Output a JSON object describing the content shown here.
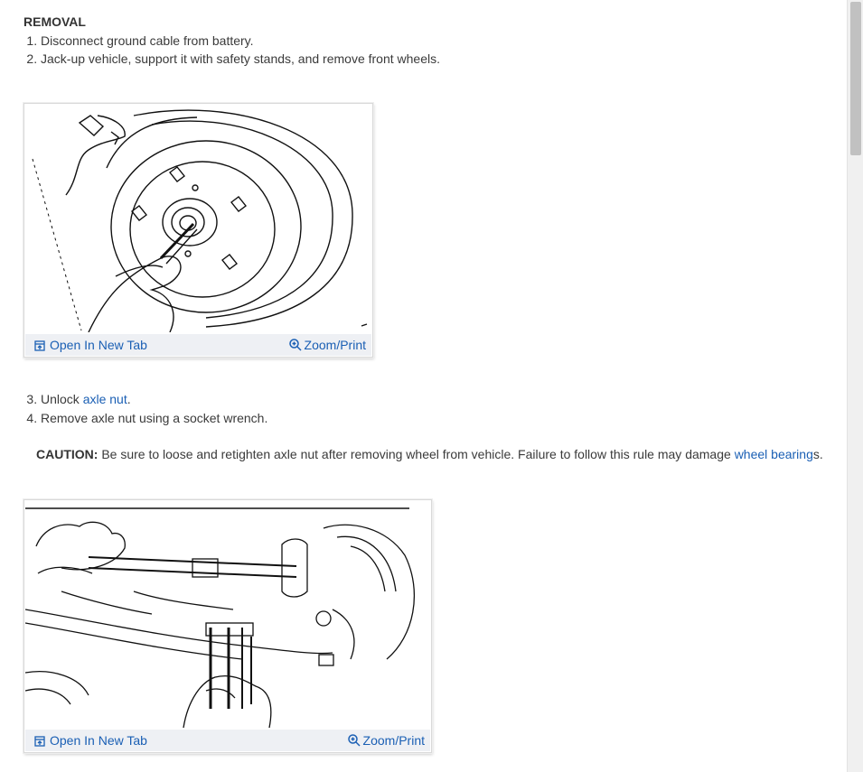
{
  "section": {
    "heading": "REMOVAL",
    "steps_1": [
      "Disconnect ground cable from battery.",
      "Jack-up vehicle, support it with safety stands, and remove front wheels."
    ],
    "step3_prefix": "Unlock ",
    "step3_link": "axle nut",
    "step3_suffix": ".",
    "step4": "Remove axle nut using a socket wrench.",
    "caution_label": "CAUTION:",
    "caution_text": " Be sure to loose and retighten axle nut after removing wheel from vehicle. Failure to follow this rule may damage ",
    "caution_link": "wheel bearing",
    "caution_link_suffix": "s."
  },
  "figures": [
    {
      "open_label": "Open In New Tab",
      "zoom_label": "Zoom/Print"
    },
    {
      "open_label": "Open In New Tab",
      "zoom_label": "Zoom/Print"
    }
  ],
  "colors": {
    "link": "#1a5fb4",
    "text": "#3a3a3a",
    "toolbar_bg": "#eef0f4"
  }
}
